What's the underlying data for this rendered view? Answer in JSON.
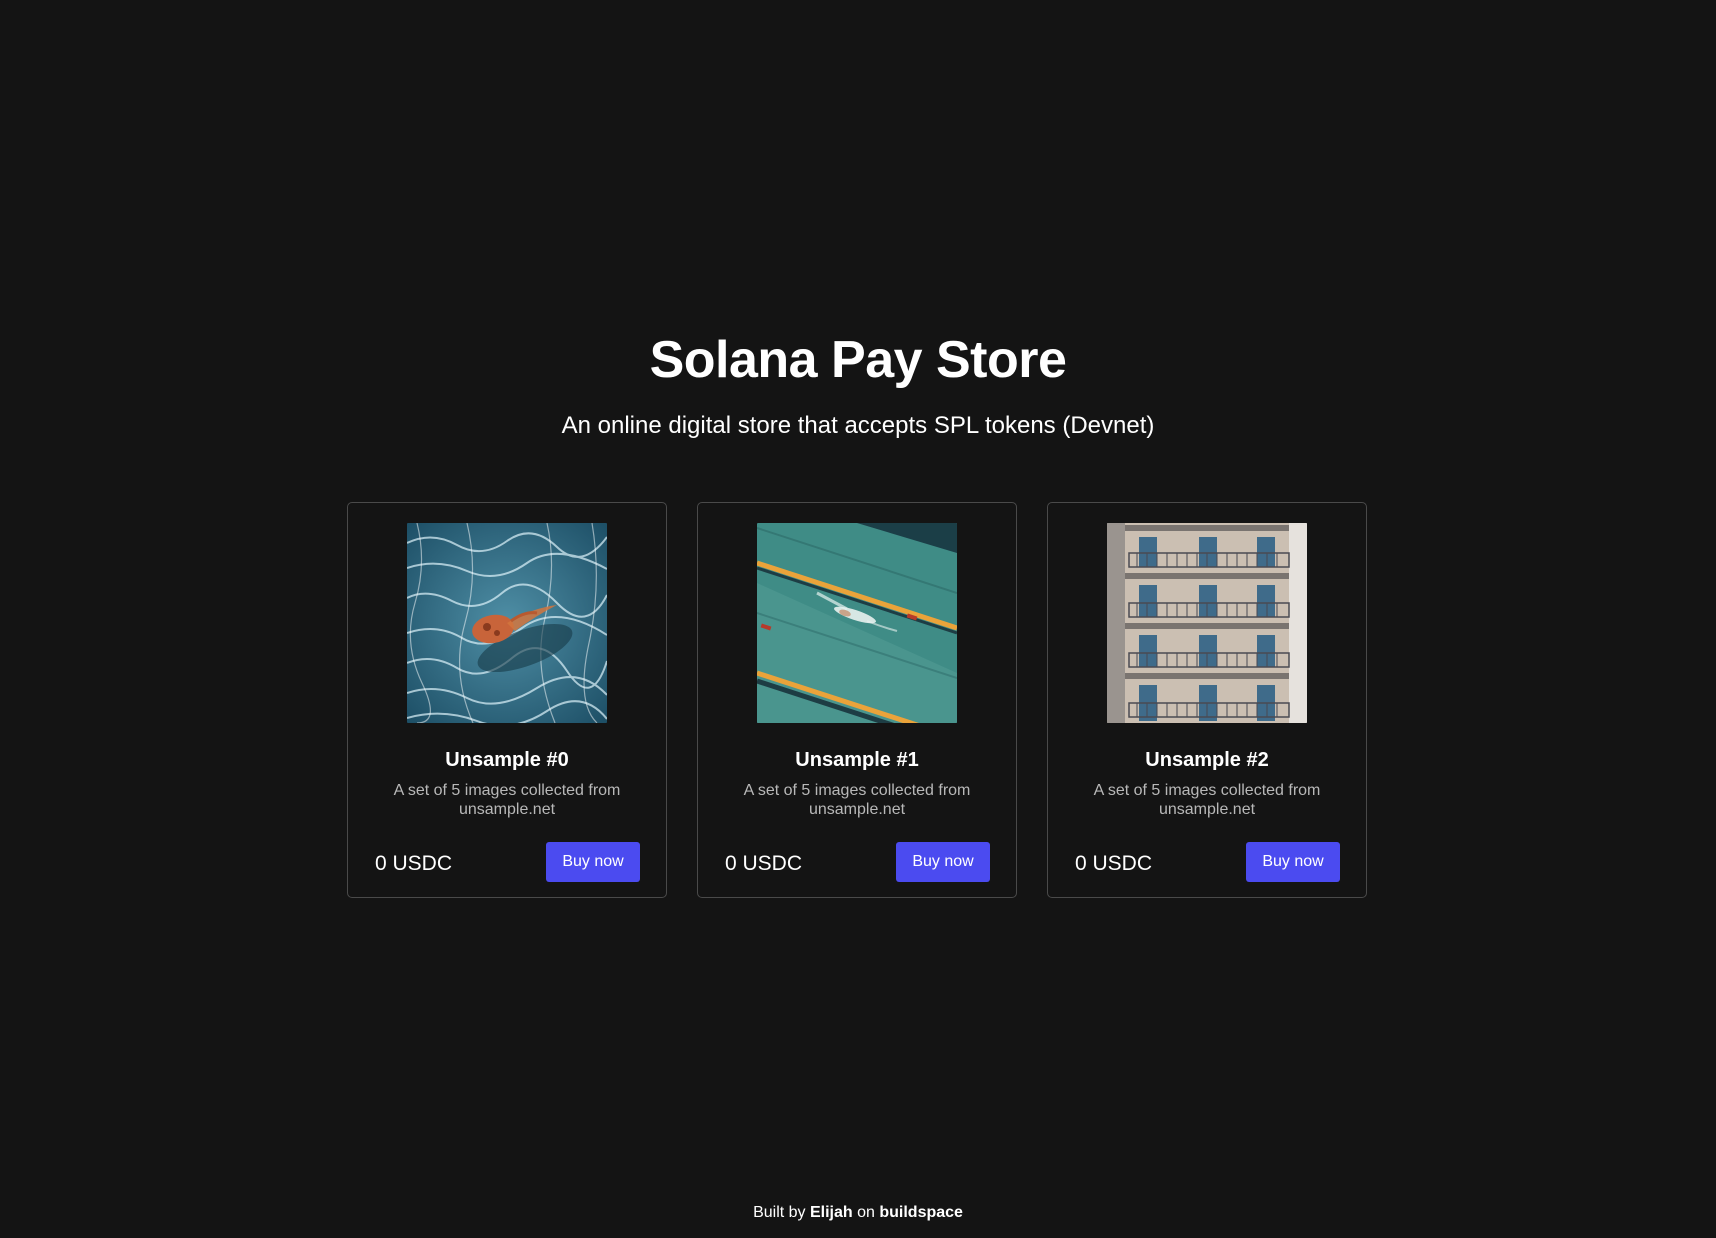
{
  "header": {
    "title": "Solana Pay Store",
    "subtitle": "An online digital store that accepts SPL tokens (Devnet)"
  },
  "products": [
    {
      "name": "Unsample #0",
      "description": "A set of 5 images collected from unsample.net",
      "price": "0 USDC",
      "button_label": "Buy now",
      "image": "jellyfish-in-water-photo"
    },
    {
      "name": "Unsample #1",
      "description": "A set of 5 images collected from unsample.net",
      "price": "0 USDC",
      "button_label": "Buy now",
      "image": "swimmer-in-pool-photo"
    },
    {
      "name": "Unsample #2",
      "description": "A set of 5 images collected from unsample.net",
      "price": "0 USDC",
      "button_label": "Buy now",
      "image": "building-facade-balconies-photo"
    }
  ],
  "footer": {
    "prefix": "Built by ",
    "author": "Elijah",
    "middle": " on ",
    "platform": "buildspace"
  },
  "colors": {
    "background": "#141414",
    "card_border": "#4a4a4a",
    "button": "#4b4bf0",
    "muted_text": "#b8b8b8"
  }
}
